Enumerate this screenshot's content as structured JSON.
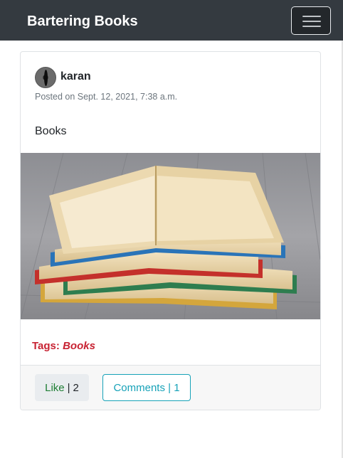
{
  "navbar": {
    "brand": "Bartering Books",
    "menu_icon": "hamburger-menu-icon"
  },
  "post": {
    "author": "karan",
    "avatar_icon": "user-avatar",
    "posted": "Posted on Sept. 12, 2021, 7:38 a.m.",
    "body": "Books",
    "image_subject": "stack-of-open-books-photo",
    "tags_label": "Tags:",
    "tags_value": "Books"
  },
  "footer": {
    "like_label": "Like",
    "like_separator": "|",
    "like_count": "2",
    "comments_label": "Comments | 1"
  },
  "colors": {
    "navbar_bg": "#343a40",
    "tag_red": "#c82333",
    "like_green": "#1e7e34",
    "comments_teal": "#17a2b8"
  }
}
